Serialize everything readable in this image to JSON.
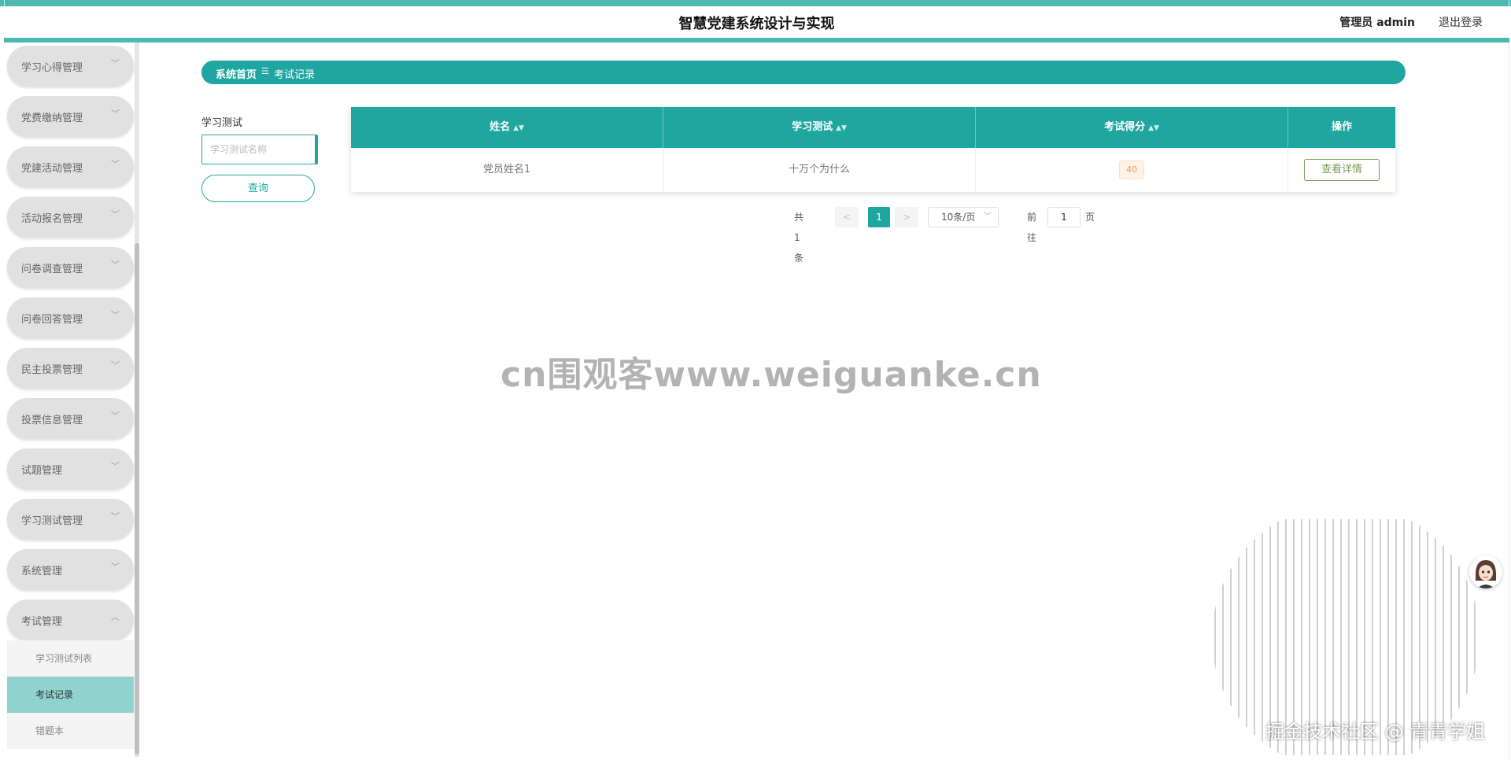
{
  "header": {
    "title": "智慧党建系统设计与实现",
    "user": "管理员 admin",
    "logout": "退出登录"
  },
  "sidebar": {
    "items": [
      {
        "label": "学习心得管理"
      },
      {
        "label": "党费缴纳管理"
      },
      {
        "label": "党建活动管理"
      },
      {
        "label": "活动报名管理"
      },
      {
        "label": "问卷调查管理"
      },
      {
        "label": "问卷回答管理"
      },
      {
        "label": "民主投票管理"
      },
      {
        "label": "投票信息管理"
      },
      {
        "label": "试题管理"
      },
      {
        "label": "学习测试管理"
      },
      {
        "label": "系统管理"
      },
      {
        "label": "考试管理"
      }
    ],
    "submenu": [
      {
        "label": "学习测试列表"
      },
      {
        "label": "考试记录"
      },
      {
        "label": "错题本"
      }
    ]
  },
  "breadcrumb": {
    "home": "系统首页",
    "separator": "☰",
    "current": "考试记录"
  },
  "search": {
    "label": "学习测试",
    "placeholder": "学习测试名称",
    "button": "查询"
  },
  "table": {
    "columns": [
      "姓名",
      "学习测试",
      "考试得分",
      "操作"
    ],
    "rows": [
      {
        "name": "党员姓名1",
        "test": "十万个为什么",
        "score": "40",
        "action": "查看详情"
      }
    ]
  },
  "pagination": {
    "total": "共 1 条",
    "prev": "<",
    "page": "1",
    "next": ">",
    "page_size": "10条/页",
    "goto_label": "前往",
    "goto_value": "1",
    "goto_unit": "页"
  },
  "watermark": "cn围观客www.weiguanke.cn",
  "footer_watermark": "掘金技术社区 @ 青青学姐",
  "icons": {
    "chevron": "chevron-down-icon",
    "chevron_open": "chevron-up-icon",
    "sort": "sort-icon"
  },
  "colors": {
    "accent": "#20a6a0",
    "accent_light": "#8fd3cf",
    "header_strip": "#4cb9b2"
  }
}
